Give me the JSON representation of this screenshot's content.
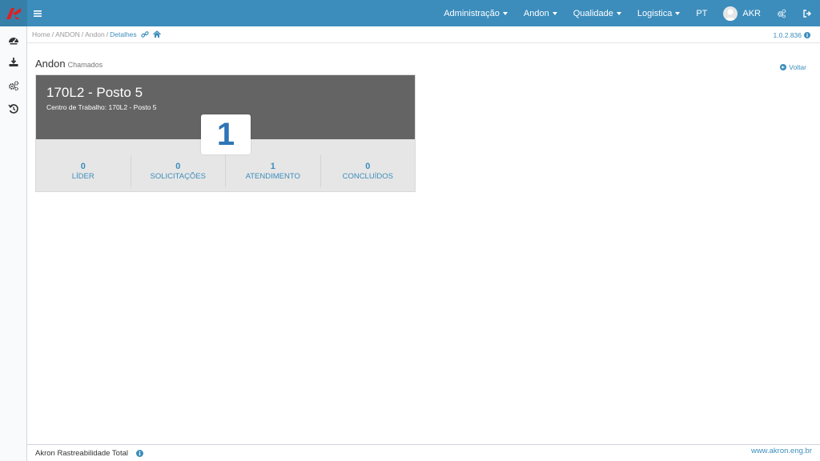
{
  "topbar": {
    "nav": [
      {
        "label": "Administração",
        "caret": true
      },
      {
        "label": "Andon",
        "caret": true
      },
      {
        "label": "Qualidade",
        "caret": true
      },
      {
        "label": "Logistica",
        "caret": true
      }
    ],
    "language": "PT",
    "user": "AKR",
    "brand_color": "#3c8dbc"
  },
  "breadcrumb": {
    "items": [
      "Home",
      "ANDON",
      "Andon",
      "Detalhes"
    ]
  },
  "version": "1.0.2.836",
  "page": {
    "title": "Andon",
    "subtitle": "Chamados",
    "back_label": "Voltar"
  },
  "station": {
    "title": "170L2 - Posto 5",
    "subtitle": "Centro de Trabalho: 170L2 - Posto 5",
    "count": "1",
    "header_color": "#646464",
    "stats": [
      {
        "value": "0",
        "label": "LÍDER"
      },
      {
        "value": "0",
        "label": "SOLICITAÇÕES"
      },
      {
        "value": "1",
        "label": "ATENDIMENTO"
      },
      {
        "value": "0",
        "label": "CONCLUÍDOS"
      }
    ]
  },
  "footer": {
    "left": "Akron Rastreabilidade Total",
    "right": "www.akron.eng.br"
  },
  "icons": {
    "sidebar": [
      "dashboard-icon",
      "download-icon",
      "cogs-icon",
      "history-icon"
    ]
  }
}
